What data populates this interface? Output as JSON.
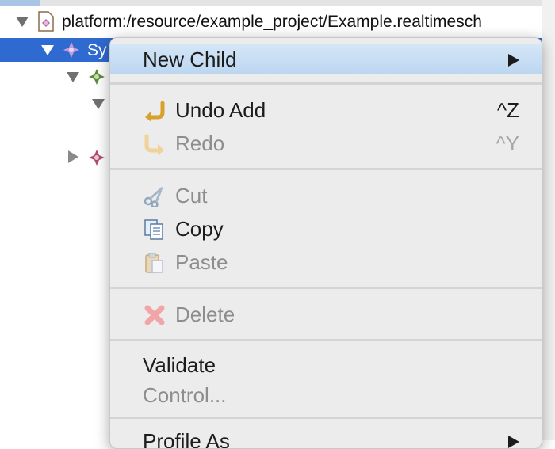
{
  "tree": {
    "rows": [
      {
        "label": "platform:/resource/example_project/Example.realtimesch"
      },
      {
        "label": "Sy"
      }
    ]
  },
  "menu": {
    "new_child": "New Child",
    "undo": {
      "label": "Undo Add",
      "shortcut": "^Z"
    },
    "redo": {
      "label": "Redo",
      "shortcut": "^Y"
    },
    "cut": "Cut",
    "copy": "Copy",
    "paste": "Paste",
    "delete": "Delete",
    "validate": "Validate",
    "control": "Control...",
    "profile_as": "Profile As"
  },
  "colors": {
    "selection": "#2f6ad0",
    "menu_background": "#ececec",
    "menu_highlight": "#c8dcf2"
  }
}
